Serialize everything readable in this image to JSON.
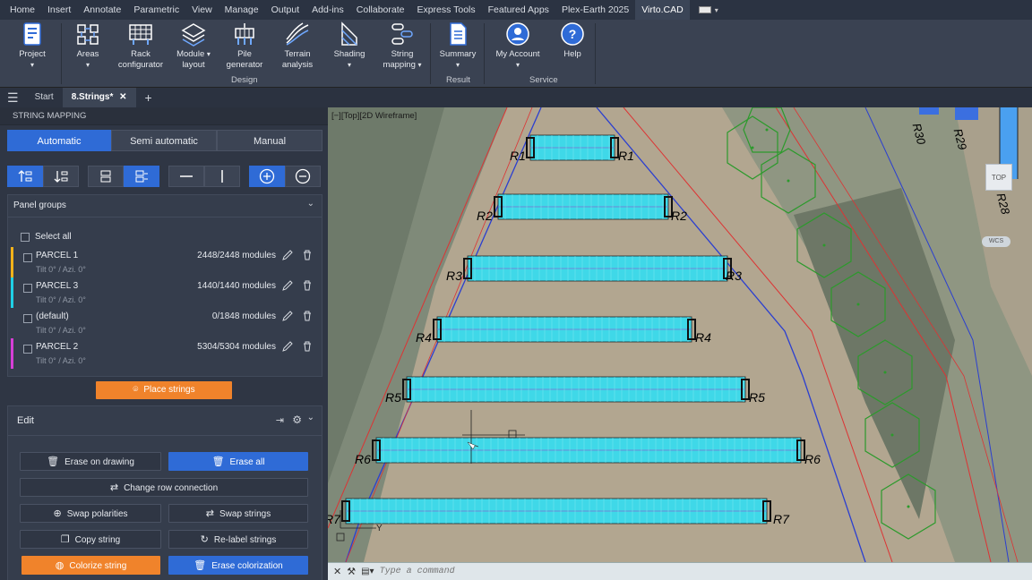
{
  "menu": [
    "Home",
    "Insert",
    "Annotate",
    "Parametric",
    "View",
    "Manage",
    "Output",
    "Add-ins",
    "Collaborate",
    "Express Tools",
    "Featured Apps",
    "Plex-Earth 2025",
    "Virto.CAD"
  ],
  "ribbon": {
    "project": {
      "label": "Project"
    },
    "areas": {
      "label": "Areas"
    },
    "rack": {
      "line1": "Rack",
      "line2": "configurator"
    },
    "module": {
      "line1": "Module",
      "line2": "layout"
    },
    "pile": {
      "line1": "Pile",
      "line2": "generator"
    },
    "terrain": {
      "line1": "Terrain",
      "line2": "analysis"
    },
    "shading": {
      "label": "Shading"
    },
    "string": {
      "line1": "String",
      "line2": "mapping"
    },
    "summary": {
      "label": "Summary"
    },
    "account": {
      "label": "My Account"
    },
    "help": {
      "label": "Help"
    },
    "groups": {
      "design": "Design",
      "result": "Result",
      "service": "Service"
    }
  },
  "tabs": {
    "start": "Start",
    "current": "8.Strings*"
  },
  "panel": {
    "title": "STRING MAPPING",
    "modes": [
      "Automatic",
      "Semi automatic",
      "Manual"
    ],
    "panel_groups": "Panel groups",
    "select_all": "Select all",
    "groups": [
      {
        "name": "PARCEL 1",
        "count": "2448/2448 modules",
        "sub": "Tilt 0° / Azi. 0°",
        "color": "#f2b21a"
      },
      {
        "name": "PARCEL 3",
        "count": "1440/1440 modules",
        "sub": "Tilt 0° / Azi. 0°",
        "color": "#1fd0e6"
      },
      {
        "name": "(default)",
        "count": "0/1848 modules",
        "sub": "Tilt 0° / Azi. 0°",
        "color": ""
      },
      {
        "name": "PARCEL 2",
        "count": "5304/5304 modules",
        "sub": "Tilt 0° / Azi. 0°",
        "color": "#d63fd6"
      }
    ],
    "place_strings": "Place strings",
    "edit": "Edit",
    "buttons": {
      "erase_drawing": "Erase on drawing",
      "erase_all": "Erase all",
      "change_row": "Change row connection",
      "swap_pol": "Swap polarities",
      "swap_str": "Swap strings",
      "copy": "Copy string",
      "relabel": "Re-label strings",
      "colorize": "Colorize string",
      "erase_color": "Erase colorization"
    }
  },
  "viewport": {
    "label": "[−][Top][2D Wireframe]",
    "rows": [
      "R1",
      "R2",
      "R3",
      "R4",
      "R5",
      "R6",
      "R7"
    ],
    "far_rows": [
      "R30",
      "R29",
      "R28"
    ],
    "top": "TOP",
    "wcs": "WCS",
    "y_axis": "Y"
  },
  "command": {
    "placeholder": "Type a command"
  }
}
